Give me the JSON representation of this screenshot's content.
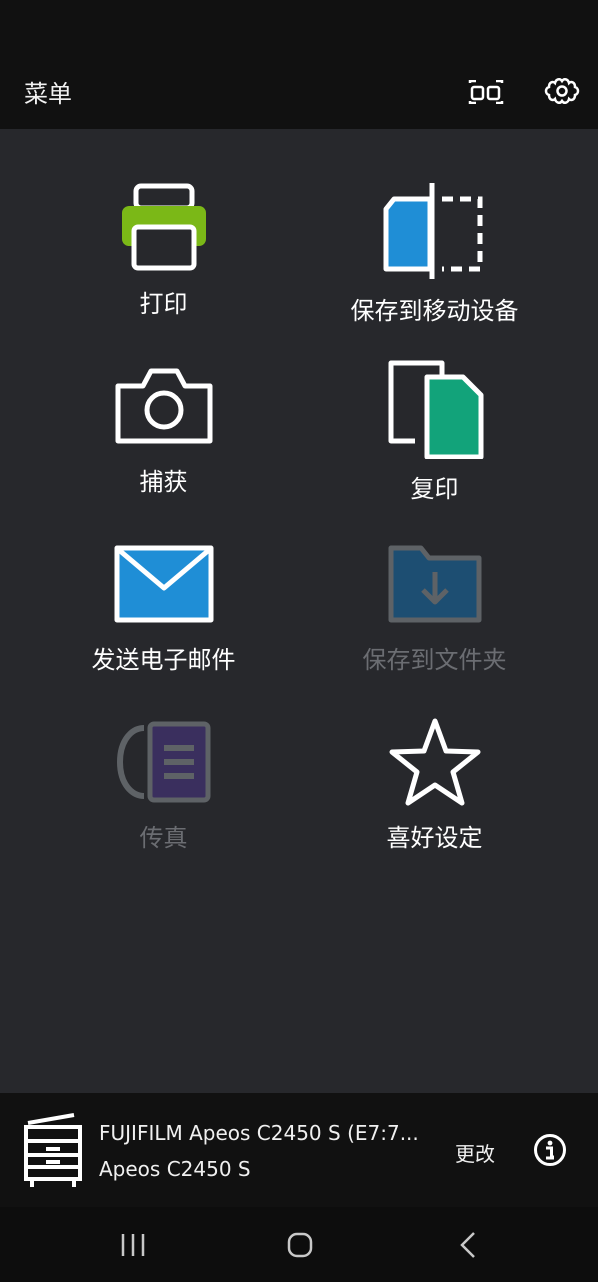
{
  "header": {
    "title": "菜单",
    "scan_icon": "barcode-scan-icon",
    "settings_icon": "gear-icon"
  },
  "menu": {
    "print": {
      "label": "打印",
      "icon": "printer-icon",
      "accent": "#7bb817"
    },
    "save_to_mobile": {
      "label": "保存到移动设备",
      "icon": "save-to-device-icon",
      "accent": "#1f8ed6"
    },
    "capture": {
      "label": "捕获",
      "icon": "camera-icon"
    },
    "copy": {
      "label": "复印",
      "icon": "copy-icon",
      "accent": "#12a37a"
    },
    "send_email": {
      "label": "发送电子邮件",
      "icon": "envelope-icon",
      "accent": "#1f8ed6"
    },
    "save_to_folder": {
      "label": "保存到文件夹",
      "icon": "folder-download-icon",
      "disabled": true
    },
    "fax": {
      "label": "传真",
      "icon": "fax-icon",
      "disabled": true
    },
    "favorites": {
      "label": "喜好设定",
      "icon": "star-icon"
    }
  },
  "device": {
    "name": "FUJIFILM Apeos C2450 S (E7:7...",
    "model": "Apeos C2450 S",
    "change_label": "更改",
    "info_icon": "info-icon"
  },
  "navigation": {
    "recents_icon": "recents-icon",
    "home_icon": "home-icon",
    "back_icon": "back-icon"
  }
}
